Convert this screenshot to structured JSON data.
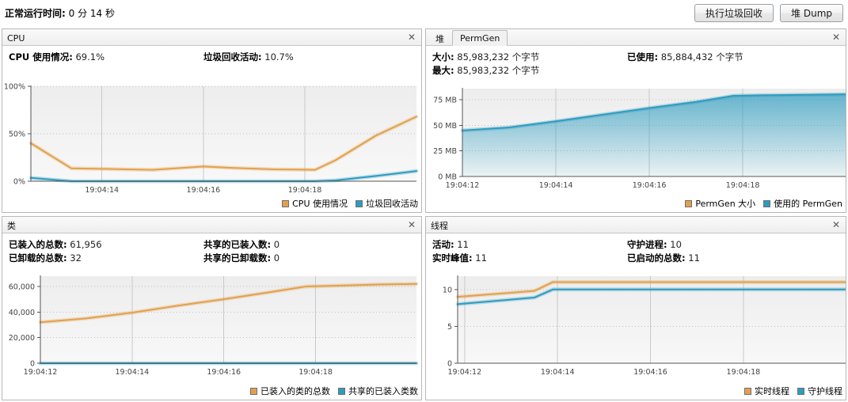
{
  "topbar": {
    "uptime_label": "正常运行时间:",
    "uptime_value": "0 分 14 秒",
    "gc_button": "执行垃圾回收",
    "heapdump_button": "堆 Dump",
    "close_icon": "✕"
  },
  "colors": {
    "orange": "#E3A04B",
    "orange_light": "#F6D9AE",
    "blue": "#2D9CC0",
    "blue_light": "#A9E2F3",
    "plot_bg_top": "#EDEDED",
    "plot_bg_bottom": "#F8F8F8",
    "grid": "#BFBFBF",
    "axis": "#555555"
  },
  "panels": {
    "cpu": {
      "title": "CPU",
      "stats": [
        {
          "key": "CPU 使用情况:",
          "value": "69.1%"
        },
        {
          "key": "垃圾回收活动:",
          "value": "10.7%"
        }
      ],
      "legend": [
        {
          "label": "CPU 使用情况",
          "color": "#E3A04B"
        },
        {
          "label": "垃圾回收活动",
          "color": "#2D9CC0"
        }
      ]
    },
    "heap": {
      "tabs": [
        {
          "label": "堆",
          "selected": false
        },
        {
          "label": "PermGen",
          "selected": true
        }
      ],
      "stats": [
        {
          "key": "大小:",
          "value": "85,983,232 个字节"
        },
        {
          "key": "已使用:",
          "value": "85,884,432 个字节"
        },
        {
          "key": "最大:",
          "value": "85,983,232 个字节"
        }
      ],
      "legend": [
        {
          "label": "PermGen 大小",
          "color": "#E3A04B"
        },
        {
          "label": "使用的 PermGen",
          "color": "#2D9CC0"
        }
      ]
    },
    "classes": {
      "title": "类",
      "stats": [
        {
          "key": "已装入的总数:",
          "value": "61,956"
        },
        {
          "key": "共享的已装入数:",
          "value": "0"
        },
        {
          "key": "已卸载的总数:",
          "value": "32"
        },
        {
          "key": "共享的已卸载数:",
          "value": "0"
        }
      ],
      "legend": [
        {
          "label": "已装入的类的总数",
          "color": "#E3A04B"
        },
        {
          "label": "共享的已装入类数",
          "color": "#2D9CC0"
        }
      ]
    },
    "threads": {
      "title": "线程",
      "stats": [
        {
          "key": "活动:",
          "value": "11"
        },
        {
          "key": "守护进程:",
          "value": "10"
        },
        {
          "key": "实时峰值:",
          "value": "11"
        },
        {
          "key": "已启动的总数:",
          "value": "11"
        }
      ],
      "legend": [
        {
          "label": "实时线程",
          "color": "#E3A04B"
        },
        {
          "label": "守护线程",
          "color": "#2D9CC0"
        }
      ]
    }
  },
  "chart_data": [
    {
      "id": "cpu",
      "type": "line",
      "title": "CPU",
      "xlabel": "",
      "ylabel": "",
      "ylim": [
        0,
        100
      ],
      "yticks": [
        0,
        50,
        100
      ],
      "ytick_labels": [
        "0%",
        "50%",
        "100%"
      ],
      "xticks": [
        14,
        16,
        18
      ],
      "xtick_labels": [
        "19:04:14",
        "19:04:16",
        "19:04:18"
      ],
      "xlim": [
        12.6,
        20.2
      ],
      "grid": true,
      "legend_position": "bottom-right",
      "series": [
        {
          "name": "CPU 使用情况",
          "color": "#E3A04B",
          "x": [
            12.6,
            13.4,
            14.0,
            15.0,
            16.0,
            16.6,
            17.4,
            18.2,
            18.6,
            19.4,
            20.2
          ],
          "y": [
            40.0,
            13.5,
            13.0,
            12.0,
            15.5,
            14.0,
            12.5,
            12.0,
            22.0,
            48.0,
            68.0
          ]
        },
        {
          "name": "垃圾回收活动",
          "color": "#2D9CC0",
          "x": [
            12.6,
            13.4,
            14.0,
            16.0,
            18.2,
            18.6,
            19.4,
            20.2
          ],
          "y": [
            3.5,
            0.0,
            0.0,
            0.0,
            0.0,
            0.8,
            5.5,
            10.7
          ]
        }
      ]
    },
    {
      "id": "permgen",
      "type": "area",
      "title": "PermGen",
      "xlabel": "",
      "ylabel": "MB",
      "ylim": [
        0,
        86
      ],
      "yticks": [
        0,
        25,
        50,
        75
      ],
      "ytick_labels": [
        "0 MB",
        "25 MB",
        "50 MB",
        "75 MB"
      ],
      "xticks": [
        12,
        14,
        16,
        18
      ],
      "xtick_labels": [
        "19:04:12",
        "19:04:14",
        "19:04:16",
        "19:04:18"
      ],
      "xlim": [
        12.0,
        20.2
      ],
      "grid": true,
      "legend_position": "bottom-right",
      "series": [
        {
          "name": "使用的 PermGen",
          "color": "#2D9CC0",
          "fill": true,
          "x": [
            12.0,
            13.0,
            14.0,
            15.0,
            16.0,
            17.0,
            17.8,
            18.4,
            19.4,
            20.2
          ],
          "y": [
            45.0,
            48.0,
            54.0,
            60.5,
            67.0,
            73.0,
            79.0,
            79.5,
            80.0,
            80.5
          ]
        },
        {
          "name": "PermGen 大小",
          "color": "#E3A04B",
          "fill": false,
          "x": [],
          "y": []
        }
      ]
    },
    {
      "id": "classes",
      "type": "line",
      "title": "类",
      "xlabel": "",
      "ylabel": "",
      "ylim": [
        0,
        68000
      ],
      "yticks": [
        0,
        20000,
        40000,
        60000
      ],
      "ytick_labels": [
        "0",
        "20,000",
        "40,000",
        "60,000"
      ],
      "xticks": [
        12,
        14,
        16,
        18
      ],
      "xtick_labels": [
        "19:04:12",
        "19:04:14",
        "19:04:16",
        "19:04:18"
      ],
      "xlim": [
        12.0,
        20.2
      ],
      "grid": true,
      "legend_position": "bottom-right",
      "series": [
        {
          "name": "已装入的类的总数",
          "color": "#E3A04B",
          "x": [
            12.0,
            13.0,
            14.0,
            15.0,
            16.0,
            17.0,
            17.8,
            18.4,
            19.4,
            20.2
          ],
          "y": [
            32000,
            35000,
            39500,
            45000,
            50000,
            55500,
            60000,
            60500,
            61500,
            61956
          ]
        },
        {
          "name": "共享的已装入类数",
          "color": "#2D9CC0",
          "x": [
            12.0,
            20.2
          ],
          "y": [
            0,
            0
          ]
        }
      ]
    },
    {
      "id": "threads",
      "type": "line",
      "title": "线程",
      "xlabel": "",
      "ylabel": "",
      "ylim": [
        0,
        11.8
      ],
      "yticks": [
        0,
        5,
        10
      ],
      "ytick_labels": [
        "0",
        "5",
        "10"
      ],
      "xticks": [
        12,
        14,
        16,
        18
      ],
      "xtick_labels": [
        "19:04:12",
        "19:04:14",
        "19:04:16",
        "19:04:18"
      ],
      "xlim": [
        11.85,
        20.2
      ],
      "grid": true,
      "legend_position": "bottom-right",
      "series": [
        {
          "name": "实时线程",
          "color": "#E3A04B",
          "x": [
            11.85,
            13.5,
            13.9,
            14.0,
            20.2
          ],
          "y": [
            9.0,
            9.8,
            11.0,
            11.0,
            11.0
          ]
        },
        {
          "name": "守护线程",
          "color": "#2D9CC0",
          "x": [
            11.85,
            13.5,
            13.9,
            14.0,
            20.2
          ],
          "y": [
            8.0,
            8.9,
            10.0,
            10.0,
            10.0
          ]
        }
      ]
    }
  ]
}
